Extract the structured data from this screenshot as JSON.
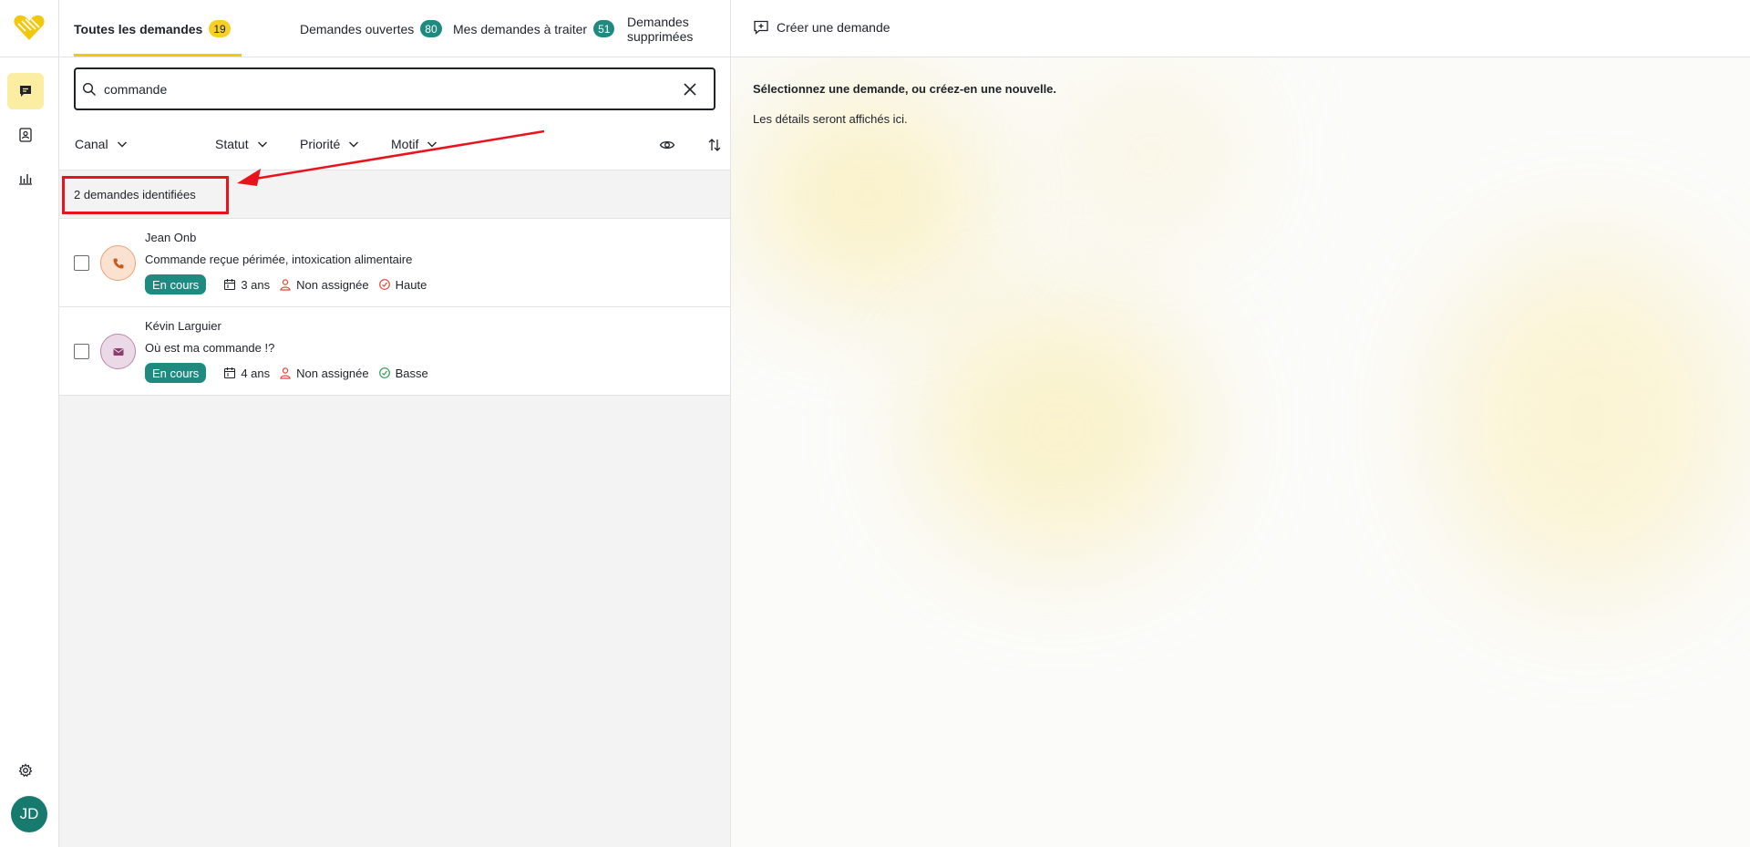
{
  "tabs": [
    {
      "label": "Toutes les demandes",
      "badge": "19"
    },
    {
      "label": "Demandes ouvertes",
      "badge": "80"
    },
    {
      "label": "Mes demandes à traiter",
      "badge": "51"
    },
    {
      "label": "Demandes supprimées"
    }
  ],
  "search": {
    "value": "commande"
  },
  "filters": {
    "channel": "Canal",
    "status": "Statut",
    "priority": "Priorité",
    "reason": "Motif"
  },
  "results": {
    "count_label": "2 demandes identifiées"
  },
  "requests": [
    {
      "name": "Jean Onb",
      "subject": "Commande reçue périmée, intoxication alimentaire",
      "status": "En cours",
      "age": "3 ans",
      "assignee": "Non assignée",
      "priority": "Haute",
      "channel_icon": "phone-icon"
    },
    {
      "name": "Kévin Larguier",
      "subject": "Où est ma commande !?",
      "status": "En cours",
      "age": "4 ans",
      "assignee": "Non assignée",
      "priority": "Basse",
      "channel_icon": "mail-icon"
    }
  ],
  "detail": {
    "create_label": "Créer une demande",
    "empty_title": "Sélectionnez une demande, ou créez-en une nouvelle.",
    "empty_subtitle": "Les détails seront affichés ici."
  },
  "user": {
    "initials": "JD"
  },
  "colors": {
    "accent": "#f2c80f",
    "teal": "#1f8a80",
    "annotation": "#e8131d",
    "priority_high": "#e0483c",
    "priority_low": "#2e9d54"
  }
}
